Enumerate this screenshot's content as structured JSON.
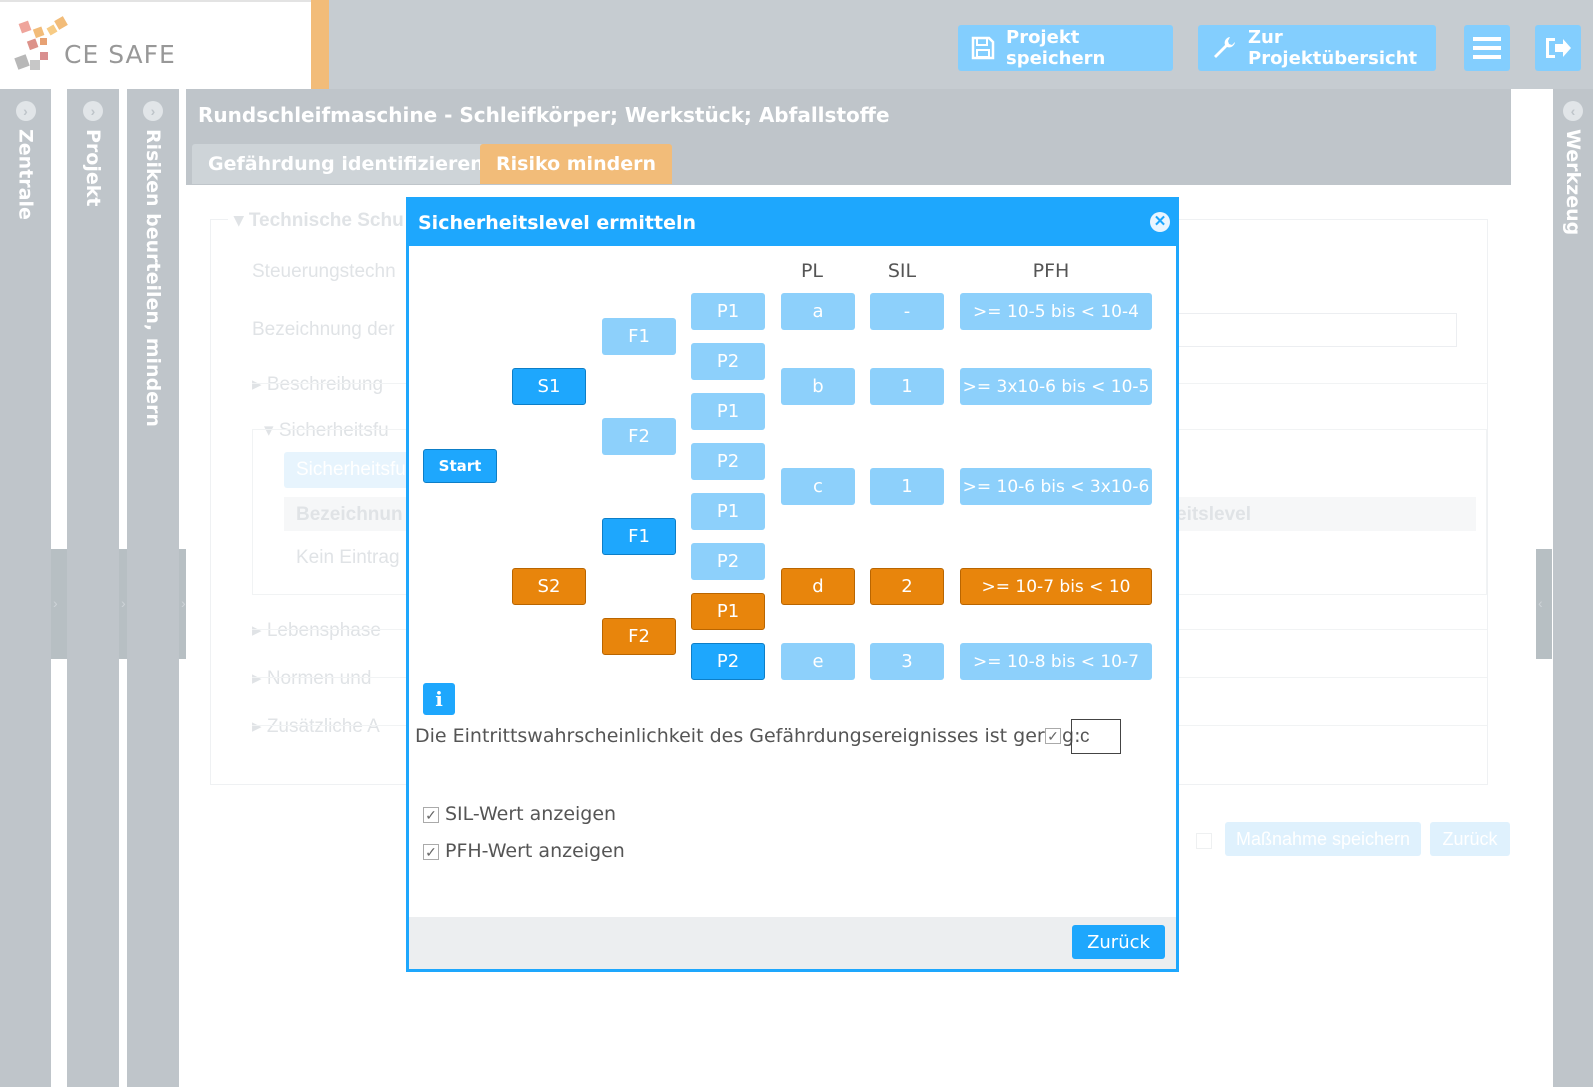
{
  "header": {
    "logo_text": "CE SAFE",
    "save_label": "Projekt speichern",
    "overview_label": "Zur Projektübersicht"
  },
  "side_panels": {
    "zentrale": "Zentrale",
    "projekt": "Projekt",
    "risiken": "Risiken beurteilen, mindern",
    "werkzeug": "Werkzeug"
  },
  "main": {
    "title": "Rundschleifmaschine - Schleifkörper; Werkstück; Abfallstoffe",
    "tabs": [
      {
        "label": "Gefährdung identifizieren"
      },
      {
        "label": "Risiko mindern"
      }
    ],
    "section_title": "Technische Schu",
    "steuerung": "Steuerungstechn",
    "bezeichnung": "Bezeichnung der",
    "beschreibung": "Beschreibung",
    "sicherheitsfu": "Sicherheitsfu",
    "sf_button": "Sicherheitsfu",
    "col_bezeichnung": "Bezeichnun",
    "col_level": "eitslevel",
    "kein_eintrag": "Kein Eintrag",
    "lebensphase": "Lebensphase",
    "normen": "Normen und",
    "zusaetzliche": "Zusätzliche A",
    "massnahme_label": "Maßnahme speichern",
    "zurueck_label": "Zurück"
  },
  "modal": {
    "title": "Sicherheitslevel ermitteln",
    "col_pl": "PL",
    "col_sil": "SIL",
    "col_pfh": "PFH",
    "start": "Start",
    "s1": "S1",
    "s2": "S2",
    "f1_top": "F1",
    "f2_top": "F2",
    "f1_bot": "F1",
    "f2_bot": "F2",
    "p": [
      "P1",
      "P2",
      "P1",
      "P2",
      "P1",
      "P2",
      "P1",
      "P2"
    ],
    "pl": [
      "a",
      "b",
      "c",
      "d",
      "e"
    ],
    "sil": [
      "-",
      "1",
      "1",
      "2",
      "3"
    ],
    "pfh": [
      ">= 10-5 bis < 10-4",
      ">= 3x10-6 bis < 10-5",
      ">= 10-6 bis < 3x10-6",
      ">= 10-7 bis < 10",
      ">= 10-8 bis < 10-7"
    ],
    "probability_text": "Die Eintrittswahrscheinlichkeit des Gefährdungsereignisses ist gering:",
    "probability_value": "c",
    "sil_checkbox": "SIL-Wert anzeigen",
    "pfh_checkbox": "PFH-Wert anzeigen",
    "back_label": "Zurück"
  },
  "colors": {
    "accent_blue": "#1ea7fd",
    "accent_orange": "#e8850c",
    "header_gray": "#97a2ab"
  }
}
